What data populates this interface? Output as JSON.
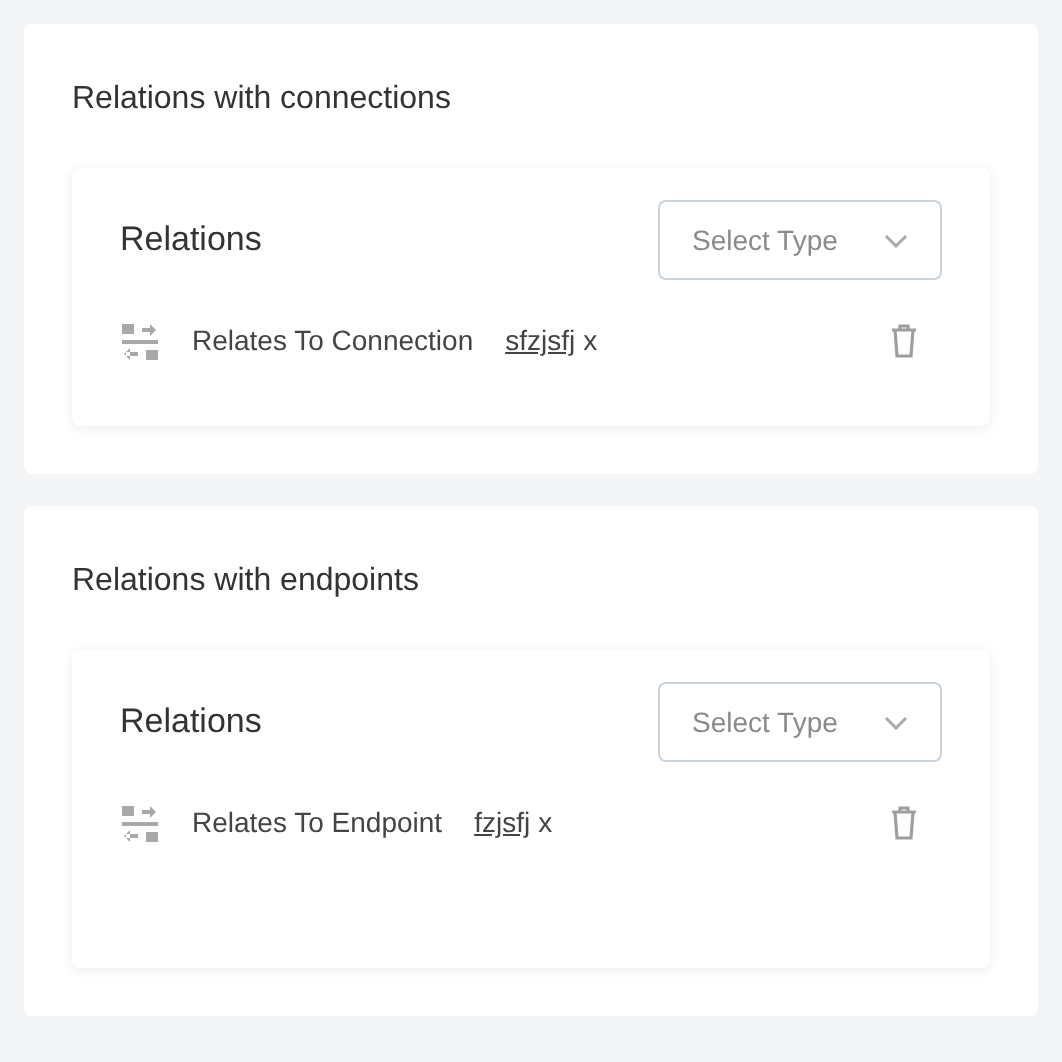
{
  "sections": [
    {
      "title": "Relations with connections",
      "panel": {
        "title": "Relations",
        "select": {
          "placeholder": "Select Type"
        },
        "relations": [
          {
            "label": "Relates To Connection",
            "value": "sfzjsfj",
            "remove": "x"
          }
        ]
      },
      "tall": false
    },
    {
      "title": "Relations with endpoints",
      "panel": {
        "title": "Relations",
        "select": {
          "placeholder": "Select Type"
        },
        "relations": [
          {
            "label": "Relates To Endpoint",
            "value": "fzjsfj",
            "remove": "x"
          }
        ]
      },
      "tall": true
    }
  ]
}
